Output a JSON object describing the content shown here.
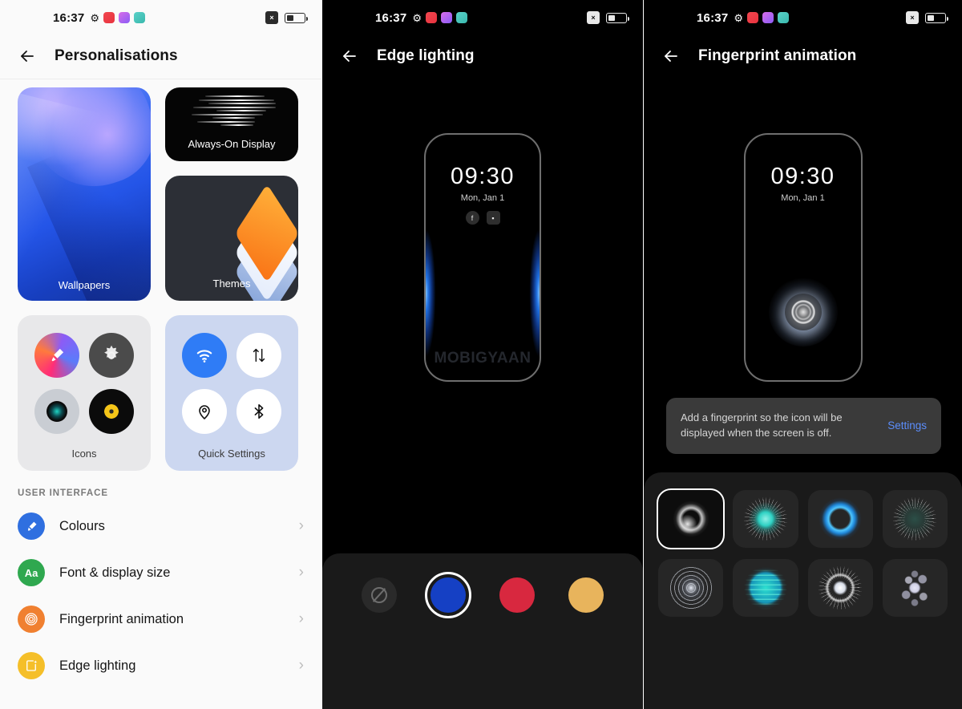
{
  "statusbar": {
    "time": "16:37",
    "gear_icon": "gear-icon",
    "app_icons": [
      "app-chip-red",
      "app-chip-purple",
      "app-chip-teal"
    ],
    "dnd_label": "×",
    "battery_level": "42"
  },
  "left_panel": {
    "title": "Personalisations",
    "back_icon": "back-arrow-icon",
    "cards": {
      "wallpapers": "Wallpapers",
      "always_on_display": "Always-On Display",
      "themes": "Themes",
      "icons": "Icons",
      "quick_settings": "Quick Settings"
    },
    "icon_tiles": [
      "paint-icon",
      "gear-icon",
      "camera-icon",
      "music-disc-icon"
    ],
    "quick_tiles": [
      "wifi-icon",
      "mobile-data-icon",
      "location-icon",
      "bluetooth-icon"
    ],
    "section_header": "USER INTERFACE",
    "list": [
      {
        "label": "Colours",
        "icon": "paint-roller-icon",
        "color": "#2f6fe0",
        "badge": ""
      },
      {
        "label": "Font & display size",
        "icon": "font-size-icon",
        "color": "#2fa84f",
        "badge": "Aa"
      },
      {
        "label": "Fingerprint animation",
        "icon": "fingerprint-icon",
        "color": "#f08030",
        "badge": ""
      },
      {
        "label": "Edge lighting",
        "icon": "edge-lighting-icon",
        "color": "#f5bf29",
        "badge": ""
      }
    ],
    "chevron": "›"
  },
  "mid_panel": {
    "title": "Edge lighting",
    "back_icon": "back-arrow-icon",
    "preview": {
      "clock": "09:30",
      "date": "Mon, Jan 1",
      "notifications": [
        "facebook-icon",
        "news-icon"
      ],
      "watermark": "MOBIGYAAN",
      "glow_color": "#1f6fe0"
    },
    "colors": [
      {
        "name": "none",
        "hex": "#2a2a2a",
        "selected": false
      },
      {
        "name": "blue",
        "hex": "#1540c4",
        "selected": true
      },
      {
        "name": "red",
        "hex": "#d8283f",
        "selected": false
      },
      {
        "name": "gold",
        "hex": "#e8b45c",
        "selected": false
      }
    ]
  },
  "right_panel": {
    "title": "Fingerprint animation",
    "back_icon": "back-arrow-icon",
    "preview": {
      "clock": "09:30",
      "date": "Mon, Jan 1",
      "fingerprint_icon": "fingerprint-glow-icon"
    },
    "banner": {
      "message": "Add a fingerprint so the icon will be displayed when the screen is off.",
      "action": "Settings",
      "action_color": "#5b8dfb"
    },
    "animations": [
      {
        "name": "halo-white",
        "selected": true
      },
      {
        "name": "burst-teal",
        "selected": false
      },
      {
        "name": "ring-blue",
        "selected": false
      },
      {
        "name": "sparks-green",
        "selected": false
      },
      {
        "name": "rings-grey",
        "selected": false
      },
      {
        "name": "sphere-teal",
        "selected": false
      },
      {
        "name": "orbit-white",
        "selected": false
      },
      {
        "name": "cluster-violet",
        "selected": false
      }
    ]
  }
}
